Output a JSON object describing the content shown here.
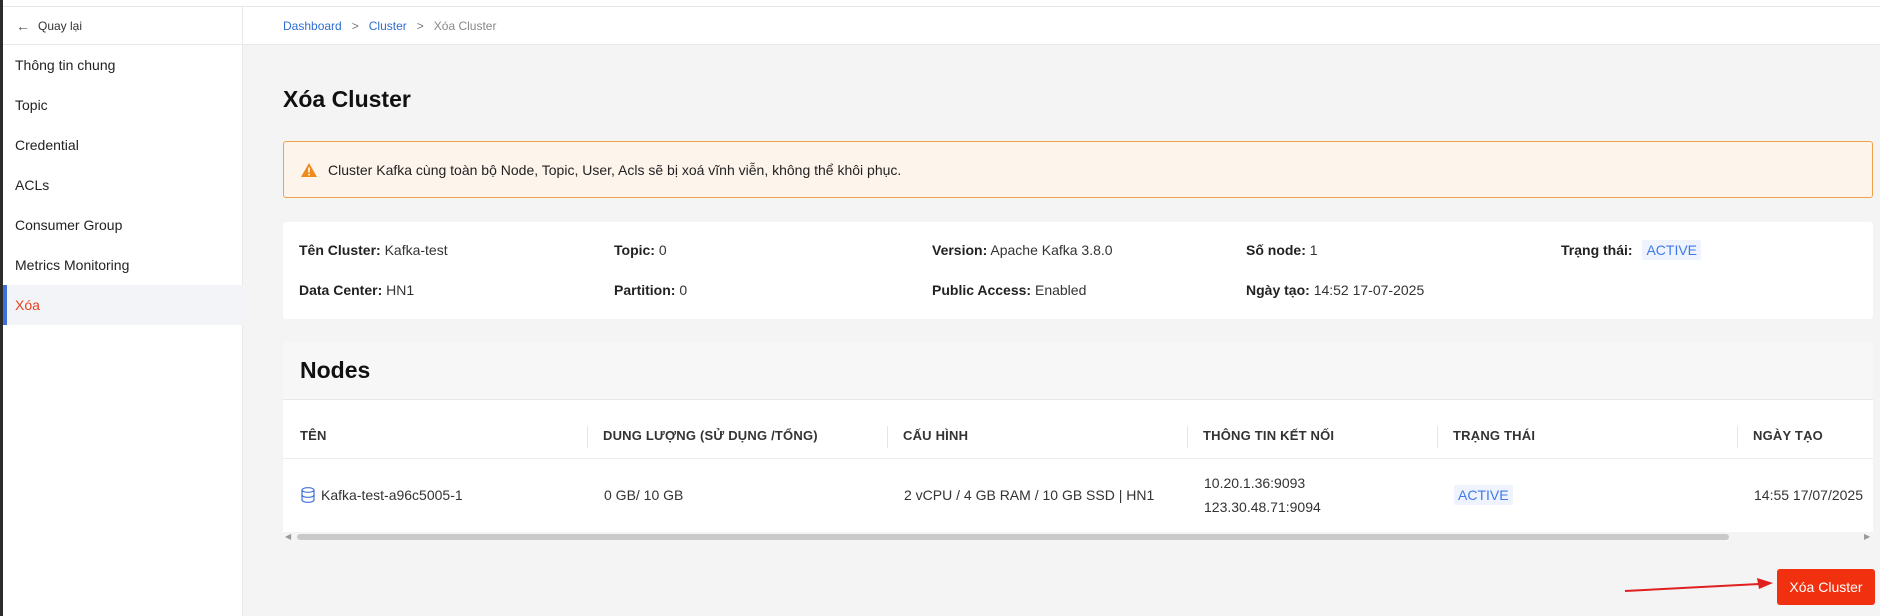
{
  "sidebar": {
    "back_label": "Quay lại",
    "items": [
      {
        "label": "Thông tin chung",
        "active": false
      },
      {
        "label": "Topic",
        "active": false
      },
      {
        "label": "Credential",
        "active": false
      },
      {
        "label": "ACLs",
        "active": false
      },
      {
        "label": "Consumer Group",
        "active": false
      },
      {
        "label": "Metrics Monitoring",
        "active": false
      },
      {
        "label": "Xóa",
        "active": true
      }
    ]
  },
  "breadcrumb": {
    "items": [
      "Dashboard",
      "Cluster",
      "Xóa Cluster"
    ],
    "separator": ">"
  },
  "page": {
    "title": "Xóa Cluster",
    "warning": "Cluster Kafka cùng toàn bộ Node, Topic, User, Acls sẽ bị xoá vĩnh viễn, không thể khôi phục."
  },
  "cluster_info": {
    "name_label": "Tên Cluster:",
    "name": "Kafka-test",
    "topic_label": "Topic:",
    "topic": "0",
    "version_label": "Version:",
    "version": "Apache Kafka 3.8.0",
    "nodes_label": "Số node:",
    "nodes": "1",
    "status_label": "Trạng thái:",
    "status": "ACTIVE",
    "datacenter_label": "Data Center:",
    "datacenter": "HN1",
    "partition_label": "Partition:",
    "partition": "0",
    "public_access_label": "Public Access:",
    "public_access": "Enabled",
    "created_label": "Ngày tạo:",
    "created": "14:52 17-07-2025"
  },
  "nodes_section": {
    "title": "Nodes",
    "columns": [
      "TÊN",
      "DUNG LƯỢNG (SỬ DỤNG /TỔNG)",
      "CẤU HÌNH",
      "THÔNG TIN KẾT NỐI",
      "TRẠNG THÁI",
      "NGÀY TẠO"
    ],
    "rows": [
      {
        "name": "Kafka-test-a96c5005-1",
        "capacity": "0 GB/ 10 GB",
        "config": "2 vCPU / 4 GB RAM / 10 GB SSD | HN1",
        "connection_1": "10.20.1.36:9093",
        "connection_2": "123.30.48.71:9094",
        "status": "ACTIVE",
        "created": "14:55 17/07/2025"
      }
    ]
  },
  "actions": {
    "delete_label": "Xóa Cluster"
  },
  "colors": {
    "accent_blue": "#3f6fd8",
    "danger": "#f0300f",
    "warning_border": "#f0a24a",
    "status_blue": "#3f7bea"
  },
  "icons": {
    "back": "arrow-left-icon",
    "warning": "warning-triangle-icon",
    "node": "database-icon",
    "annotation": "red-arrow-annotation"
  }
}
